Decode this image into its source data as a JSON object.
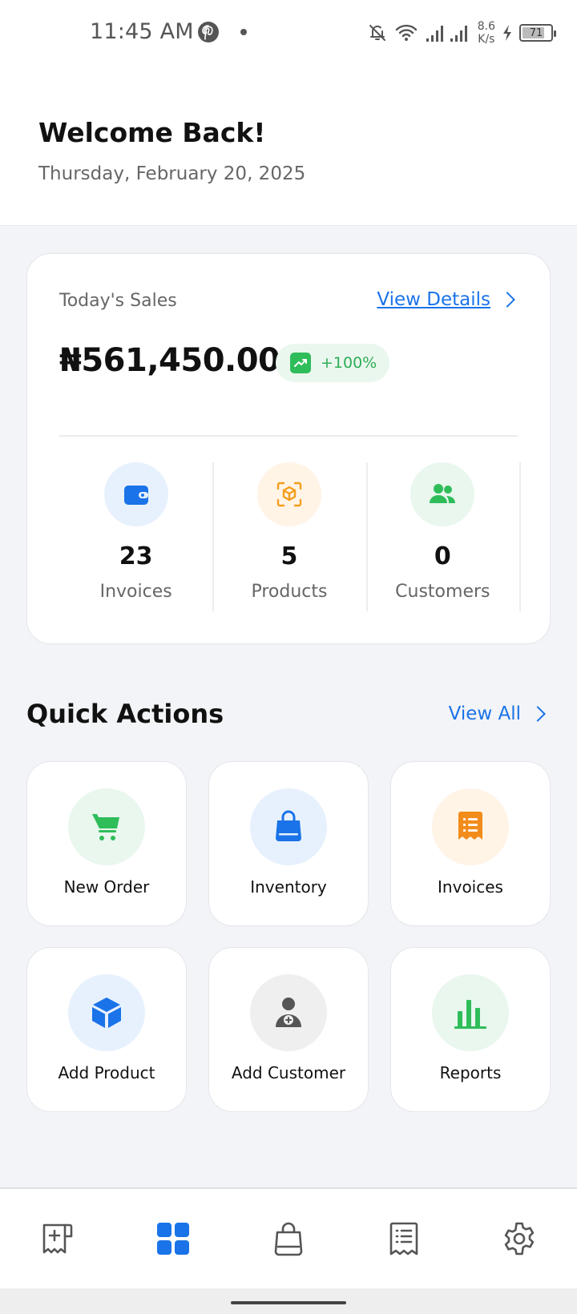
{
  "status_bar": {
    "time": "11:45 AM",
    "net_speed_value": "8.6",
    "net_speed_unit": "K/s",
    "battery": "71",
    "icons": [
      "pinterest-icon",
      "bell-off-icon",
      "wifi-icon",
      "signal-icon",
      "charging-icon"
    ]
  },
  "header": {
    "welcome": "Welcome Back!",
    "date": "Thursday, February 20, 2025"
  },
  "sales_card": {
    "label": "Today's Sales",
    "view_details": "View Details",
    "amount": "₦561,450.00",
    "growth": "+100%",
    "stats": [
      {
        "value": "23",
        "label": "Invoices",
        "icon": "wallet-icon",
        "color": "#1a73e8",
        "bg": "#e7f1fd"
      },
      {
        "value": "5",
        "label": "Products",
        "icon": "scan-box-icon",
        "color": "#f59e1b",
        "bg": "#fff4e6"
      },
      {
        "value": "0",
        "label": "Customers",
        "icon": "users-icon",
        "color": "#2fbd5a",
        "bg": "#e9f7ee"
      }
    ]
  },
  "quick_actions": {
    "title": "Quick Actions",
    "view_all": "View All",
    "items": [
      {
        "label": "New Order",
        "icon": "cart-icon",
        "color": "#2fbd5a",
        "bg": "#e9f7ee"
      },
      {
        "label": "Inventory",
        "icon": "shopping-bag-icon",
        "color": "#1a73e8",
        "bg": "#e7f1fd"
      },
      {
        "label": "Invoices",
        "icon": "receipt-icon",
        "color": "#f28c1b",
        "bg": "#fff4e6"
      },
      {
        "label": "Add Product",
        "icon": "cube-icon",
        "color": "#1a73e8",
        "bg": "#e7f1fd"
      },
      {
        "label": "Add Customer",
        "icon": "user-add-icon",
        "color": "#555555",
        "bg": "#efefef"
      },
      {
        "label": "Reports",
        "icon": "bar-chart-icon",
        "color": "#2fbd5a",
        "bg": "#e9f7ee"
      }
    ]
  },
  "bottom_nav": {
    "items": [
      "add-invoice-icon",
      "dashboard-icon",
      "bag-icon",
      "receipt-list-icon",
      "settings-icon"
    ],
    "active_color": "#1a73e8",
    "inactive_color": "#555555"
  }
}
